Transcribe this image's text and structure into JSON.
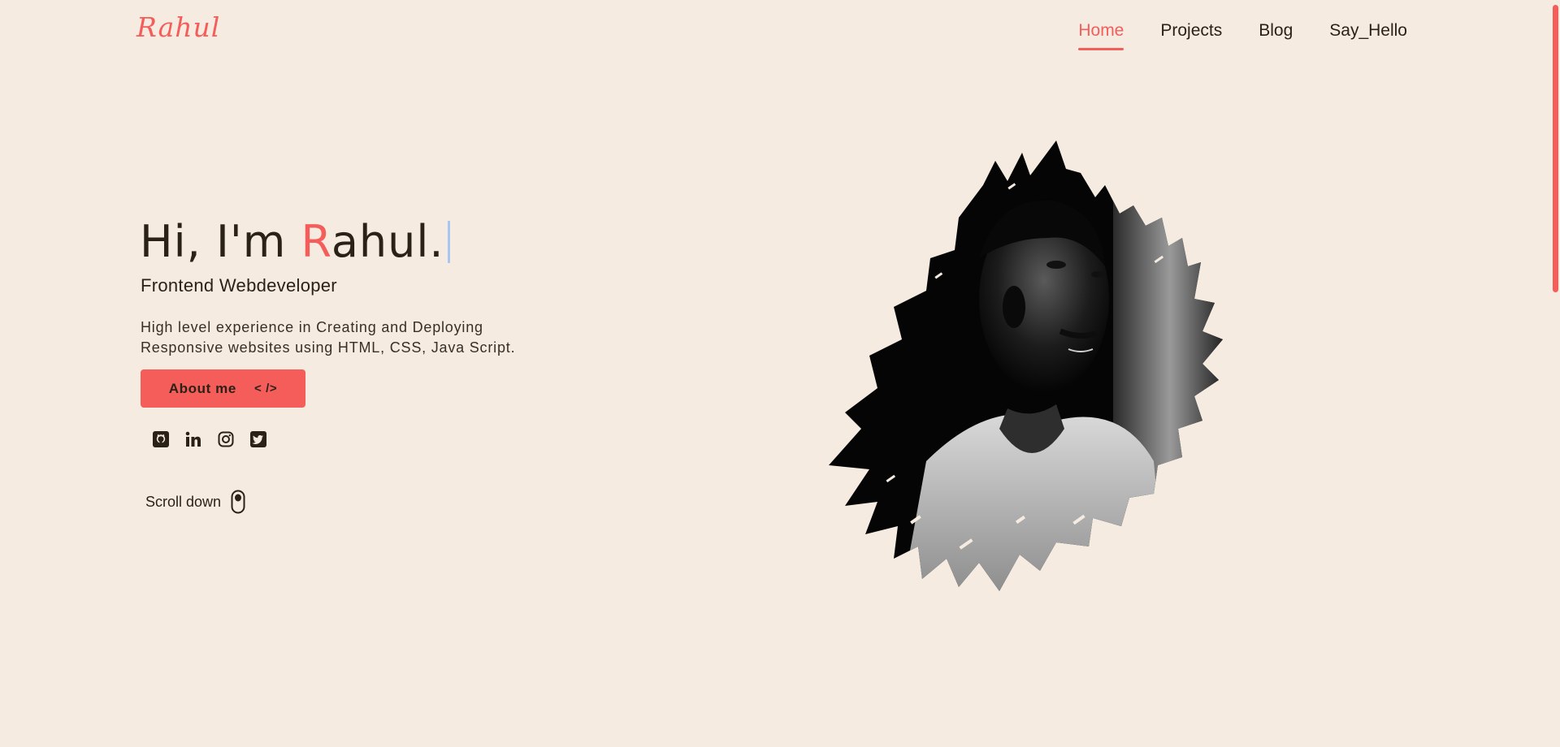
{
  "header": {
    "logo": "Rahul",
    "nav": [
      {
        "label": "Home",
        "active": true
      },
      {
        "label": "Projects",
        "active": false
      },
      {
        "label": "Blog",
        "active": false
      },
      {
        "label": "Say_Hello",
        "active": false
      }
    ]
  },
  "hero": {
    "greeting_prefix": "Hi, I'm ",
    "name_initial": "R",
    "name_rest": "ahul.",
    "subtitle": "Frontend Webdeveloper",
    "description_line1": "High level experience in Creating and Deploying",
    "description_line2": "Responsive websites using HTML, CSS, Java Script.",
    "about_button": "About me",
    "about_button_code": "< />",
    "socials": [
      "github-icon",
      "linkedin-icon",
      "instagram-icon",
      "twitter-icon"
    ],
    "scroll_down": "Scroll down"
  },
  "colors": {
    "background": "#f5ebe1",
    "accent": "#f45d5a",
    "text": "#2b2217"
  }
}
